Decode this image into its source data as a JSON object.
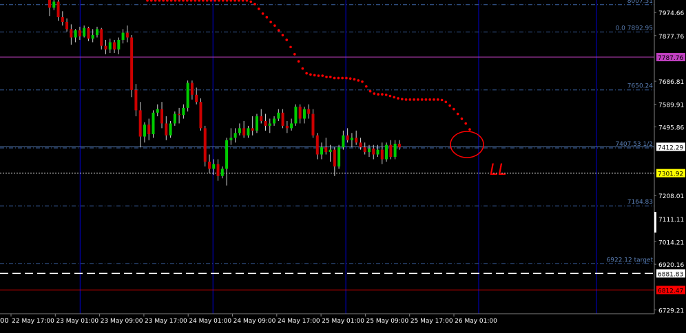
{
  "chart_data": {
    "type": "candlestick",
    "ylim": [
      6713,
      8027
    ],
    "y_ticks": [
      "7974.66",
      "7877.76",
      "7686.81",
      "7589.91",
      "7495.86",
      "7208.01",
      "7111.11",
      "7014.21",
      "6920.16",
      "6729.21"
    ],
    "x_ticks": [
      "22 May 17:00",
      "23 May 01:00",
      "23 May 09:00",
      "23 May 17:00",
      "24 May 01:00",
      "24 May 09:00",
      "24 May 17:00",
      "25 May 01:00",
      "25 May 09:00",
      "25 May 17:00",
      "26 May 01:00"
    ],
    "leading_tick_fragment": "00",
    "levels": [
      {
        "label": "8007.51",
        "value": 8007.51,
        "style": "dashdot",
        "color": "#3c64a6"
      },
      {
        "label": "0.0  7892.95",
        "value": 7892.95,
        "style": "dashdot",
        "color": "#3c64a6"
      },
      {
        "label": "7650.24",
        "value": 7650.24,
        "style": "dashdot",
        "color": "#3c64a6"
      },
      {
        "label": "7407.53 1/2",
        "value": 7407.53,
        "style": "dashdot",
        "color": "#3c64a6"
      },
      {
        "label": "7164.83",
        "value": 7164.83,
        "style": "dashdot",
        "color": "#3c64a6"
      },
      {
        "label": "6922.12 target",
        "value": 6922.12,
        "style": "dashdot",
        "color": "#3c64a6"
      }
    ],
    "price_lines": [
      {
        "label": "7787.76",
        "value": 7787.76,
        "color": "#c040c0",
        "style": "solid",
        "box_bg": "#c040c0",
        "box_fg": "#000000"
      },
      {
        "label": "7412.29",
        "value": 7412.29,
        "color": "#5a7fb5",
        "style": "solid",
        "box_bg": "#ffffff",
        "box_fg": "#000000"
      },
      {
        "label": "7301.92",
        "value": 7301.92,
        "color": "#ffffff",
        "style": "dotted",
        "box_bg": "#ffff00",
        "box_fg": "#000000"
      },
      {
        "label": "6881.83",
        "value": 6881.83,
        "color": "#ffffff",
        "style": "dashed",
        "box_bg": "#ffffff",
        "box_fg": "#000000"
      },
      {
        "label": "6812.47",
        "value": 6812.47,
        "color": "#ff0000",
        "style": "solid",
        "box_bg": "#ff0000",
        "box_fg": "#000000"
      }
    ],
    "session_separators": [
      "23 May 01:00",
      "24 May 01:00",
      "25 May 01:00",
      "26 May 01:00",
      "26 May 17:00"
    ],
    "candles": [
      [
        8027,
        8027,
        7960,
        7995
      ],
      [
        7995,
        8027,
        7985,
        8020
      ],
      [
        8020,
        8027,
        7940,
        7955
      ],
      [
        7955,
        7980,
        7920,
        7935
      ],
      [
        7935,
        7950,
        7895,
        7905
      ],
      [
        7905,
        7925,
        7840,
        7870
      ],
      [
        7870,
        7905,
        7850,
        7900
      ],
      [
        7900,
        7915,
        7860,
        7875
      ],
      [
        7875,
        7920,
        7870,
        7910
      ],
      [
        7910,
        7915,
        7855,
        7865
      ],
      [
        7865,
        7905,
        7850,
        7880
      ],
      [
        7880,
        7915,
        7870,
        7905
      ],
      [
        7905,
        7910,
        7820,
        7835
      ],
      [
        7835,
        7860,
        7800,
        7820
      ],
      [
        7820,
        7865,
        7805,
        7850
      ],
      [
        7850,
        7860,
        7805,
        7820
      ],
      [
        7820,
        7870,
        7800,
        7860
      ],
      [
        7860,
        7905,
        7845,
        7890
      ],
      [
        7890,
        7920,
        7850,
        7870
      ],
      [
        7870,
        7880,
        7620,
        7650
      ],
      [
        7650,
        7675,
        7540,
        7565
      ],
      [
        7565,
        7600,
        7410,
        7455
      ],
      [
        7455,
        7515,
        7430,
        7505
      ],
      [
        7505,
        7530,
        7440,
        7465
      ],
      [
        7465,
        7565,
        7450,
        7555
      ],
      [
        7555,
        7590,
        7540,
        7570
      ],
      [
        7570,
        7600,
        7490,
        7510
      ],
      [
        7510,
        7540,
        7440,
        7460
      ],
      [
        7460,
        7520,
        7450,
        7510
      ],
      [
        7510,
        7560,
        7500,
        7550
      ],
      [
        7550,
        7575,
        7510,
        7545
      ],
      [
        7545,
        7590,
        7530,
        7575
      ],
      [
        7575,
        7690,
        7560,
        7680
      ],
      [
        7680,
        7690,
        7610,
        7630
      ],
      [
        7630,
        7660,
        7590,
        7600
      ],
      [
        7600,
        7615,
        7480,
        7490
      ],
      [
        7490,
        7500,
        7330,
        7350
      ],
      [
        7350,
        7380,
        7300,
        7320
      ],
      [
        7320,
        7360,
        7295,
        7340
      ],
      [
        7340,
        7360,
        7270,
        7290
      ],
      [
        7290,
        7330,
        7280,
        7320
      ],
      [
        7320,
        7450,
        7250,
        7440
      ],
      [
        7440,
        7490,
        7420,
        7450
      ],
      [
        7450,
        7490,
        7430,
        7470
      ],
      [
        7470,
        7510,
        7460,
        7490
      ],
      [
        7490,
        7520,
        7450,
        7460
      ],
      [
        7460,
        7500,
        7450,
        7490
      ],
      [
        7490,
        7540,
        7460,
        7480
      ],
      [
        7480,
        7550,
        7470,
        7540
      ],
      [
        7540,
        7570,
        7510,
        7520
      ],
      [
        7520,
        7550,
        7480,
        7500
      ],
      [
        7500,
        7530,
        7470,
        7510
      ],
      [
        7510,
        7540,
        7500,
        7530
      ],
      [
        7530,
        7570,
        7520,
        7555
      ],
      [
        7555,
        7570,
        7490,
        7500
      ],
      [
        7500,
        7520,
        7470,
        7490
      ],
      [
        7490,
        7530,
        7480,
        7510
      ],
      [
        7510,
        7590,
        7500,
        7580
      ],
      [
        7580,
        7590,
        7510,
        7530
      ],
      [
        7530,
        7580,
        7510,
        7570
      ],
      [
        7570,
        7590,
        7530,
        7550
      ],
      [
        7550,
        7570,
        7450,
        7460
      ],
      [
        7460,
        7470,
        7360,
        7380
      ],
      [
        7380,
        7430,
        7360,
        7410
      ],
      [
        7410,
        7450,
        7380,
        7390
      ],
      [
        7390,
        7420,
        7350,
        7400
      ],
      [
        7400,
        7410,
        7290,
        7330
      ],
      [
        7330,
        7420,
        7320,
        7410
      ],
      [
        7410,
        7480,
        7400,
        7460
      ],
      [
        7460,
        7490,
        7430,
        7440
      ],
      [
        7440,
        7470,
        7410,
        7450
      ],
      [
        7450,
        7480,
        7420,
        7430
      ],
      [
        7430,
        7450,
        7400,
        7410
      ],
      [
        7410,
        7430,
        7380,
        7390
      ],
      [
        7390,
        7420,
        7370,
        7405
      ],
      [
        7405,
        7420,
        7360,
        7380
      ],
      [
        7380,
        7420,
        7370,
        7400
      ],
      [
        7400,
        7430,
        7340,
        7360
      ],
      [
        7360,
        7430,
        7350,
        7420
      ],
      [
        7420,
        7440,
        7360,
        7370
      ],
      [
        7370,
        7440,
        7360,
        7425
      ],
      [
        7425,
        7440,
        7400,
        7410
      ]
    ],
    "sar_dots": [
      [
        0,
        8025
      ],
      [
        1,
        8025
      ],
      [
        2,
        8025
      ],
      [
        3,
        8025
      ],
      [
        4,
        8025
      ],
      [
        5,
        8025
      ],
      [
        6,
        8025
      ],
      [
        7,
        8025
      ],
      [
        8,
        8025
      ],
      [
        9,
        8025
      ],
      [
        10,
        8025
      ],
      [
        11,
        8025
      ],
      [
        12,
        8025
      ],
      [
        13,
        8025
      ],
      [
        14,
        8025
      ],
      [
        15,
        8025
      ],
      [
        16,
        8025
      ],
      [
        17,
        8025
      ],
      [
        18,
        8025
      ],
      [
        19,
        8025
      ],
      [
        20,
        8025
      ],
      [
        21,
        8025
      ],
      [
        22,
        8025
      ],
      [
        23,
        8025
      ],
      [
        24,
        8025
      ],
      [
        25,
        8025
      ],
      [
        26,
        8020
      ],
      [
        27,
        8010
      ],
      [
        28,
        7990
      ],
      [
        29,
        7970
      ],
      [
        30,
        7955
      ],
      [
        31,
        7935
      ],
      [
        32,
        7920
      ],
      [
        33,
        7900
      ],
      [
        34,
        7880
      ],
      [
        35,
        7860
      ],
      [
        36,
        7830
      ],
      [
        37,
        7800
      ],
      [
        38,
        7770
      ],
      [
        39,
        7740
      ],
      [
        40,
        7720
      ],
      [
        41,
        7715
      ],
      [
        42,
        7712
      ],
      [
        43,
        7710
      ],
      [
        44,
        7710
      ],
      [
        45,
        7705
      ],
      [
        46,
        7705
      ],
      [
        47,
        7700
      ],
      [
        48,
        7700
      ],
      [
        49,
        7700
      ],
      [
        50,
        7700
      ],
      [
        51,
        7698
      ],
      [
        52,
        7695
      ],
      [
        53,
        7690
      ],
      [
        54,
        7685
      ],
      [
        55,
        7665
      ],
      [
        56,
        7645
      ],
      [
        57,
        7635
      ],
      [
        58,
        7632
      ],
      [
        59,
        7632
      ],
      [
        60,
        7630
      ],
      [
        61,
        7625
      ],
      [
        62,
        7620
      ],
      [
        63,
        7615
      ],
      [
        64,
        7612
      ],
      [
        65,
        7610
      ],
      [
        66,
        7610
      ],
      [
        67,
        7610
      ],
      [
        68,
        7610
      ],
      [
        69,
        7610
      ],
      [
        70,
        7610
      ],
      [
        71,
        7610
      ],
      [
        72,
        7610
      ],
      [
        73,
        7610
      ],
      [
        74,
        7608
      ],
      [
        75,
        7600
      ],
      [
        76,
        7585
      ],
      [
        77,
        7570
      ],
      [
        78,
        7550
      ],
      [
        79,
        7530
      ],
      [
        80,
        7510
      ],
      [
        81,
        7485
      ]
    ],
    "annotation": {
      "text": "LL",
      "color": "#ff0000"
    },
    "up_color": "#00cc00",
    "down_color": "#cc0000",
    "wick_color": "#cfcfcf",
    "background": "#000000",
    "axis_text_color": "#ffffff",
    "separator_color": "#0000cc"
  }
}
